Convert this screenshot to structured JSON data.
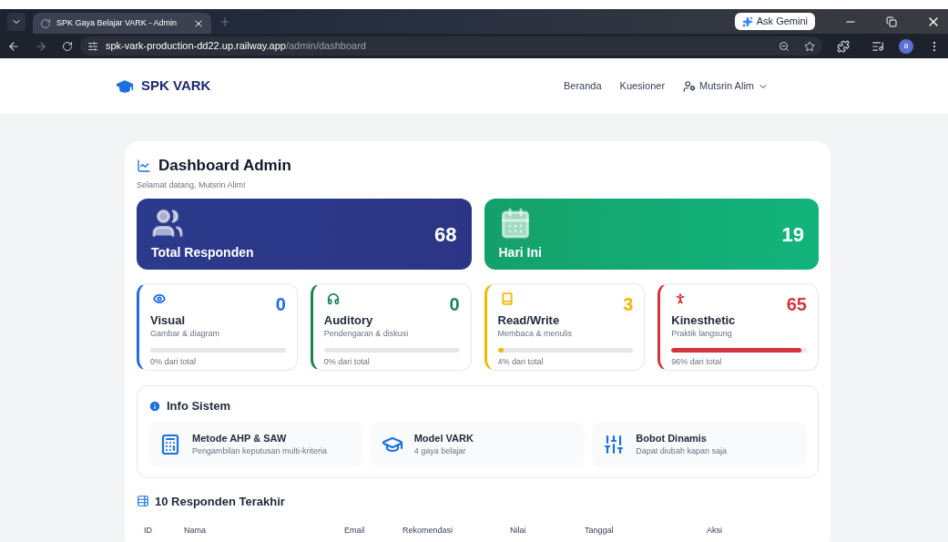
{
  "browser": {
    "tab_title": "SPK Gaya Belajar VARK - Admin",
    "url_host": "spk-vark-production-dd22.up.railway.app",
    "url_path": "/admin/dashboard",
    "gemini": "Ask Gemini",
    "profile_initial": "a"
  },
  "navbar": {
    "brand": "SPK VARK",
    "links": [
      "Beranda",
      "Kuesioner"
    ],
    "user": "Mutsrin Alim"
  },
  "header": {
    "title": "Dashboard Admin",
    "subtitle": "Selamat datang, Mutsrin Alim!"
  },
  "summary": [
    {
      "kind": "total",
      "label": "Total Responden",
      "value": "68"
    },
    {
      "kind": "today",
      "label": "Hari Ini",
      "value": "19"
    }
  ],
  "styles": [
    {
      "kind": "visual",
      "name": "Visual",
      "desc": "Gambar & diagram",
      "value": "0",
      "color": "#1f6fe0",
      "level": 0,
      "share": "0% dari total"
    },
    {
      "kind": "auditory",
      "name": "Auditory",
      "desc": "Pendengaran & diskusi",
      "value": "0",
      "color": "#198754",
      "level": 0,
      "share": "0% dari total"
    },
    {
      "kind": "read_write",
      "name": "Read/Write",
      "desc": "Membaca & menulis",
      "value": "3",
      "color": "#f5b800",
      "level": 0.04,
      "share": "4% dari total"
    },
    {
      "kind": "kinesthetic",
      "name": "Kinesthetic",
      "desc": "Praktik langsung",
      "value": "65",
      "color": "#d63340",
      "level": 0.96,
      "share": "96% dari total"
    }
  ],
  "info": {
    "title": "Info Sistem",
    "items": [
      {
        "kind": "method",
        "title": "Metode AHP & SAW",
        "desc": "Pengambilan keputusan multi-kriteria"
      },
      {
        "kind": "model",
        "title": "Model VARK",
        "desc": "4 gaya belajar"
      },
      {
        "kind": "weights",
        "title": "Bobot Dinamis",
        "desc": "Dapat diubah kapan saja"
      }
    ]
  },
  "table": {
    "title": "10 Responden Terakhir",
    "columns": [
      "ID",
      "Nama",
      "Email",
      "Rekomendasi",
      "Nilai",
      "Tanggal",
      "Aksi"
    ]
  }
}
